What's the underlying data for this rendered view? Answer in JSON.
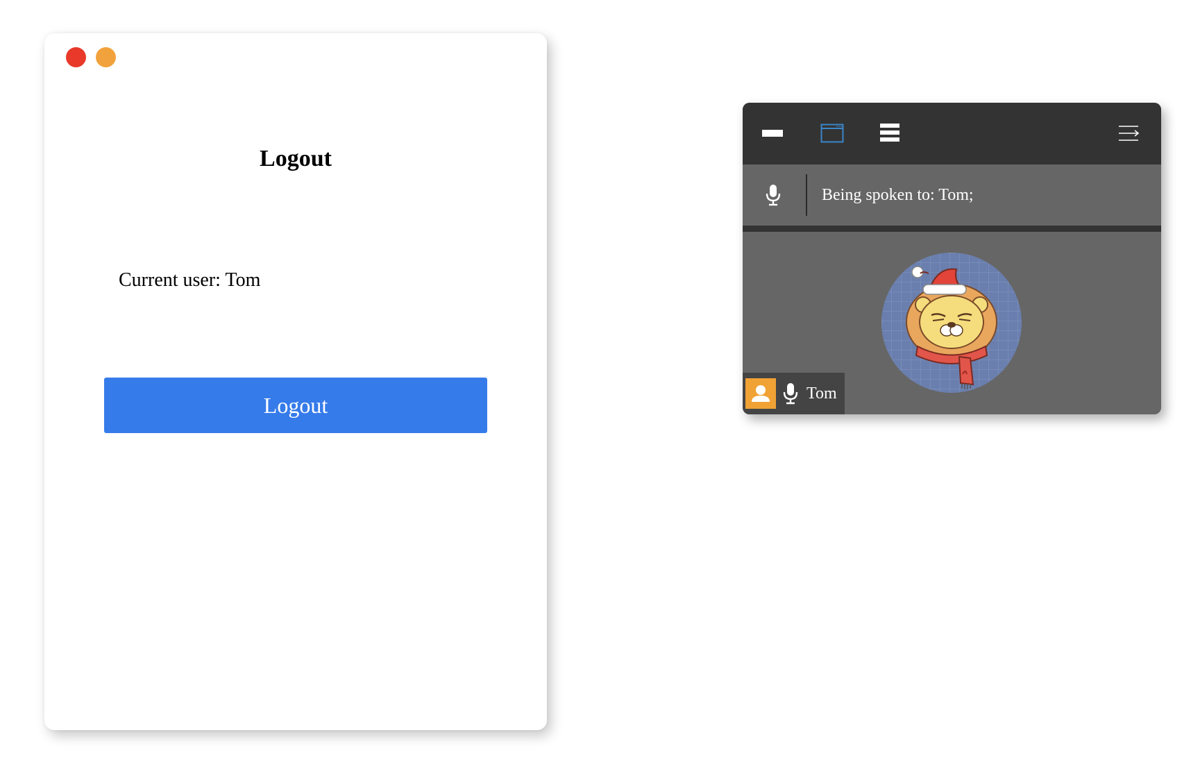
{
  "logout_window": {
    "title": "Logout",
    "current_user_text": "Current user: Tom",
    "logout_button_label": "Logout",
    "close_color": "#E8392A",
    "minimize_color": "#F2A23C",
    "button_color": "#367BEA"
  },
  "voice_panel": {
    "toolbar": {
      "icons": [
        "minimize-bar-icon",
        "window-icon",
        "list-icon",
        "collapse-menu-icon"
      ],
      "active_icon_color": "#3A86C8"
    },
    "status": {
      "icon": "microphone-icon",
      "text": "Being spoken to: Tom;"
    },
    "participant": {
      "name": "Tom",
      "avatar": "lion-santa-hat-avatar",
      "badge_color": "#F0A235",
      "mic_icon": "microphone-icon"
    }
  }
}
